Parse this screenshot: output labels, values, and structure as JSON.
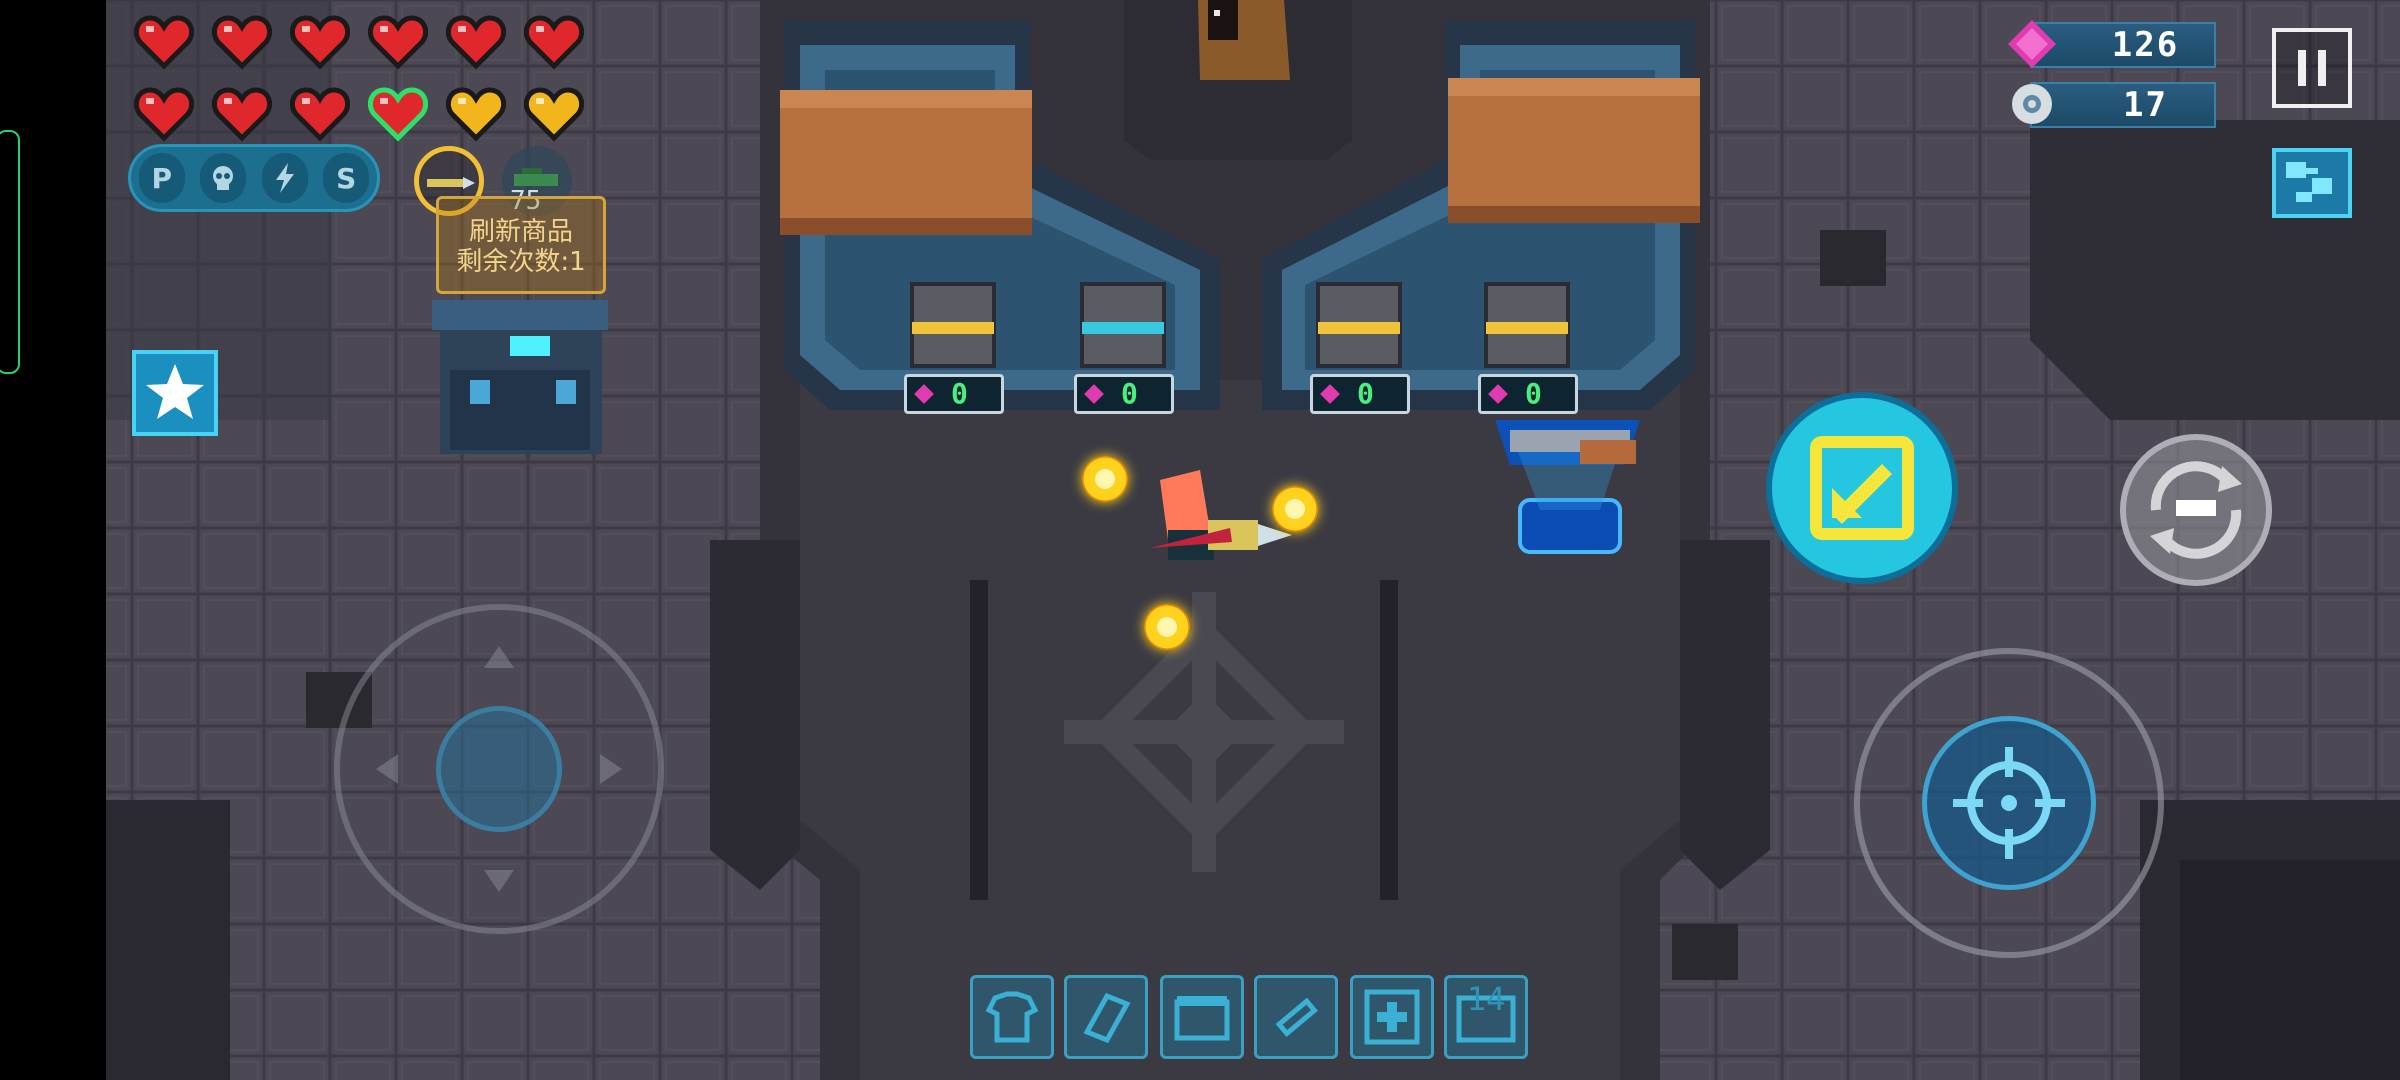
{
  "hud": {
    "hearts": {
      "rows": [
        [
          "red",
          "red",
          "red",
          "red",
          "red",
          "red"
        ],
        [
          "red",
          "red",
          "red",
          "red-selected",
          "gold",
          "gold"
        ]
      ]
    },
    "skills": [
      "P",
      "skull-icon",
      "lightning-icon",
      "S"
    ],
    "gems": "126",
    "energy": "17",
    "colors": {
      "heart_red": "#e0282c",
      "heart_gold": "#f3b51c",
      "accent": "#25c6e0",
      "gem": "#e03bb0"
    }
  },
  "shop": {
    "refresh_title": "刷新商品",
    "refresh_remaining": "剩余次数:1",
    "price": "75",
    "price_tags": [
      "0",
      "0",
      "0",
      "0"
    ]
  },
  "inventory": {
    "slots": [
      "shirt-icon",
      "cards-icon",
      "chest-icon",
      "syringe-icon",
      "plus-icon",
      "case-icon"
    ],
    "count": "14"
  }
}
